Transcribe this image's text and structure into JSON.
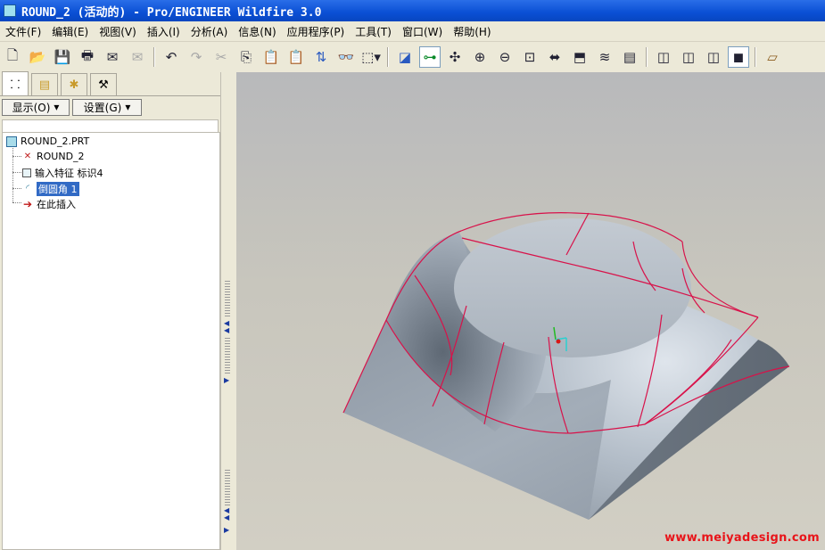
{
  "window": {
    "title": "ROUND_2 (活动的) - Pro/ENGINEER Wildfire 3.0"
  },
  "menu": [
    "文件(F)",
    "编辑(E)",
    "视图(V)",
    "插入(I)",
    "分析(A)",
    "信息(N)",
    "应用程序(P)",
    "工具(T)",
    "窗口(W)",
    "帮助(H)"
  ],
  "toolbar_icons": [
    "new-file-icon",
    "open-folder-icon",
    "save-icon",
    "print-icon",
    "email-icon",
    "email-send-icon",
    "undo-icon",
    "redo-icon",
    "cut-icon",
    "copy-icon",
    "paste-icon",
    "paste-special-icon",
    "regenerate-icon",
    "find-icon",
    "select-box-icon",
    "repaint-icon",
    "spin-center-icon",
    "orient-icon",
    "zoom-in-icon",
    "zoom-out-icon",
    "refit-icon",
    "view-normal-icon",
    "named-views-icon",
    "layers-icon",
    "view-manager-icon",
    "shading-wireframe-icon",
    "hidden-line-icon",
    "no-hidden-icon",
    "shading-icon",
    "datum-plane-icon"
  ],
  "left_panel": {
    "tabs": [
      "model-tree-tab",
      "folder-browser-tab",
      "favorites-tab",
      "connections-tab"
    ],
    "display_btn": "显示(O)",
    "settings_btn": "设置(G)",
    "tree": {
      "root": "ROUND_2.PRT",
      "items": [
        {
          "label": "ROUND_2",
          "icon": "coordinate-system-icon"
        },
        {
          "label": "输入特征 标识4",
          "icon": "import-feature-icon"
        },
        {
          "label": "倒圆角 1",
          "icon": "round-feature-icon",
          "selected": true
        },
        {
          "label": "在此插入",
          "icon": "insert-here-arrow-icon"
        }
      ]
    }
  },
  "watermark": "www.meiyadesign.com",
  "colors": {
    "title_bar": "#0a4fd4",
    "edge_highlight": "#d8124a",
    "part": "#9ba5b0",
    "selection": "#316ac5"
  }
}
